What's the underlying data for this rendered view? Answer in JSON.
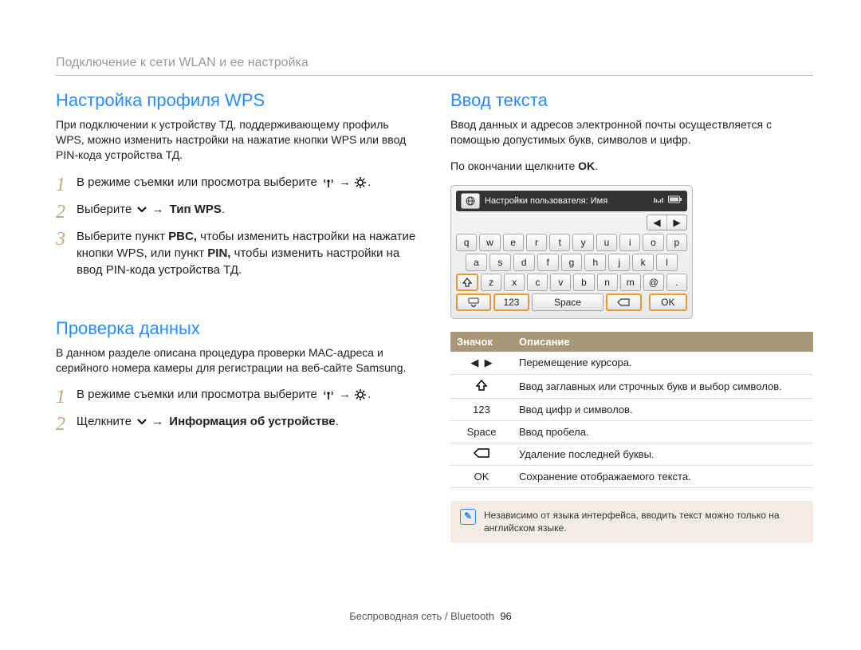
{
  "header": {
    "title": "Подключение к сети WLAN и ее настройка"
  },
  "left": {
    "section1": {
      "title": "Настройка профиля WPS",
      "intro": "При подключении к устройству ТД, поддерживающему профиль WPS, можно изменить настройки на нажатие кнопки WPS или ввод PIN-кода устройства ТД.",
      "steps": [
        {
          "num": "1",
          "pre": "В режиме съемки или просмотра выберите ",
          "post": "."
        },
        {
          "num": "2",
          "pre": "Выберите ",
          "bold": "Тип WPS",
          "post2": "."
        },
        {
          "num": "3",
          "chunks": {
            "a": "Выберите пункт ",
            "pbc": "PBC,",
            "b": " чтобы изменить настройки на нажатие кнопки WPS, или пункт ",
            "pin": "PIN,",
            "c": " чтобы изменить настройки на ввод PIN-кода устройства ТД."
          }
        }
      ]
    },
    "section2": {
      "title": "Проверка данных",
      "intro": "В данном разделе описана процедура проверки MAC-адреса и серийного номера камеры для регистрации на веб-сайте Samsung.",
      "steps": [
        {
          "num": "1",
          "pre": "В режиме съемки или просмотра выберите ",
          "post": "."
        },
        {
          "num": "2",
          "pre": "Щелкните ",
          "bold": "Информация об устройстве",
          "post2": "."
        }
      ]
    }
  },
  "right": {
    "title": "Ввод текста",
    "intro": "Ввод данных и адресов электронной почты осуществляется с помощью допустимых букв, символов и цифр.",
    "afterPre": "По окончании щелкните ",
    "afterBold": "OK",
    "afterPost": ".",
    "keyboard": {
      "status": {
        "label": "Настройки пользователя: Имя"
      },
      "row1": [
        "q",
        "w",
        "e",
        "r",
        "t",
        "y",
        "u",
        "i",
        "o",
        "p"
      ],
      "row2": [
        "a",
        "s",
        "d",
        "f",
        "g",
        "h",
        "j",
        "k",
        "l"
      ],
      "row3": [
        "z",
        "x",
        "c",
        "v",
        "b",
        "n",
        "m",
        "@",
        "."
      ],
      "row4": {
        "num": "123",
        "space": "Space",
        "ok": "OK"
      }
    },
    "table": {
      "headIcon": "Значок",
      "headDesc": "Описание",
      "rows": [
        {
          "icon": "◀ ▶",
          "desc": "Перемещение курсора."
        },
        {
          "icon": "shift",
          "desc": "Ввод заглавных или строчных букв и выбор символов."
        },
        {
          "icon": "123",
          "desc": "Ввод цифр и символов."
        },
        {
          "icon": "Space",
          "desc": "Ввод пробела."
        },
        {
          "icon": "back",
          "desc": "Удаление последней буквы."
        },
        {
          "icon": "OK",
          "desc": "Сохранение отображаемого текста."
        }
      ]
    },
    "note": "Независимо от языка интерфейса, вводить текст можно только на английском языке."
  },
  "footer": {
    "section": "Беспроводная сеть / Bluetooth",
    "page": "96"
  }
}
